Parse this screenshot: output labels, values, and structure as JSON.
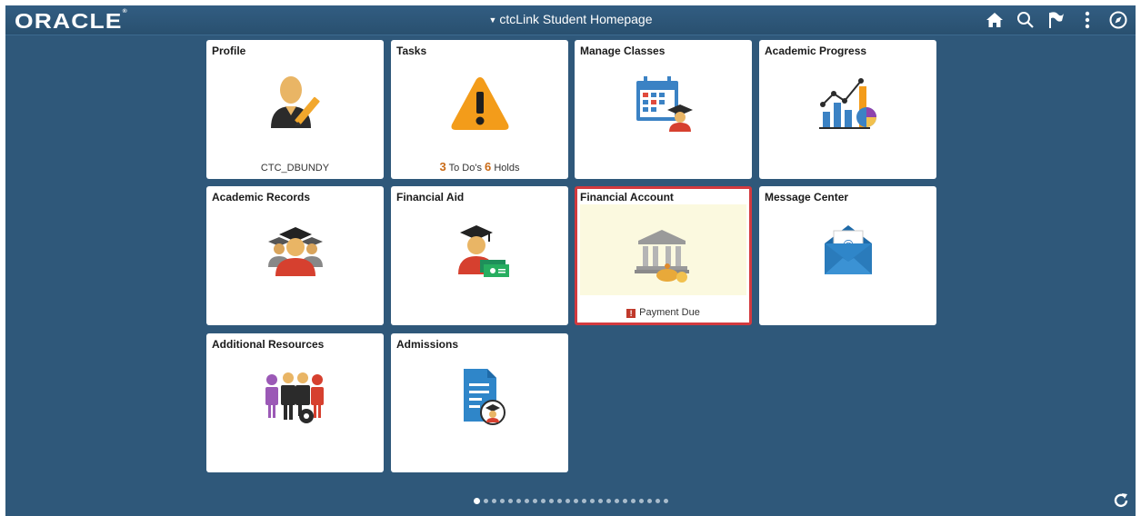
{
  "header": {
    "logo": "ORACLE",
    "title": "ctcLink Student Homepage",
    "icons": [
      "home-icon",
      "search-icon",
      "flag-icon",
      "more-icon",
      "compass-icon"
    ]
  },
  "tiles": [
    {
      "title": "Profile",
      "icon": "profile-icon",
      "footer": "CTC_DBUNDY"
    },
    {
      "title": "Tasks",
      "icon": "warning-icon",
      "todos_count": "3",
      "todos_label": "To Do's",
      "holds_count": "6",
      "holds_label": "Holds"
    },
    {
      "title": "Manage Classes",
      "icon": "calendar-student-icon"
    },
    {
      "title": "Academic Progress",
      "icon": "charts-icon"
    },
    {
      "title": "Academic Records",
      "icon": "students-icon"
    },
    {
      "title": "Financial Aid",
      "icon": "graduate-money-icon"
    },
    {
      "title": "Financial Account",
      "icon": "bank-icon",
      "footer": "Payment Due",
      "alert_icon": "alert-icon",
      "selected": true
    },
    {
      "title": "Message Center",
      "icon": "envelope-icon"
    },
    {
      "title": "Additional Resources",
      "icon": "people-gear-icon"
    },
    {
      "title": "Admissions",
      "icon": "document-student-icon"
    }
  ],
  "pagination": {
    "total": 24,
    "active": 1
  },
  "colors": {
    "background": "#2f587a",
    "tile": "#ffffff",
    "selected_border": "#d33a3f",
    "highlight": "#fbf9df",
    "count": "#c96a16"
  }
}
